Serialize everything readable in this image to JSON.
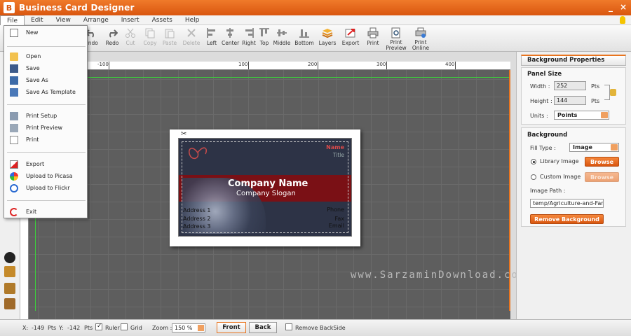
{
  "window": {
    "title": "Business Card Designer",
    "logo": "B",
    "minimize": "_",
    "close": "×"
  },
  "menubar": [
    "File",
    "Edit",
    "View",
    "Arrange",
    "Insert",
    "Assets",
    "Help"
  ],
  "toolbar": {
    "undo": "Undo",
    "redo": "Redo",
    "cut": "Cut",
    "copy": "Copy",
    "paste": "Paste",
    "delete": "Delete",
    "left": "Left",
    "center": "Center",
    "right": "Right",
    "top": "Top",
    "middle": "Middle",
    "bottom": "Bottom",
    "layers": "Layers",
    "export": "Export",
    "print": "Print",
    "print_preview": "Print Preview",
    "print_online": "Print Online"
  },
  "file_menu": {
    "new": "New",
    "open": "Open",
    "save": "Save",
    "save_as": "Save As",
    "save_as_template": "Save As Template",
    "print_setup": "Print Setup",
    "print_preview": "Print Preview",
    "print": "Print",
    "export": "Export",
    "upload_picasa": "Upload to Picasa",
    "upload_flickr": "Upload to Flickr",
    "exit": "Exit"
  },
  "ruler": {
    "labels": [
      "-100",
      "100",
      "200",
      "300",
      "400"
    ]
  },
  "card": {
    "name_small": "Name",
    "title_small": "Title",
    "company_name": "Company Name",
    "company_slogan": "Company Slogan",
    "address1": "Address 1",
    "address2": "Address 2",
    "address3": "Address 3",
    "phone": "Phone",
    "fax": "Fax",
    "email": "Email"
  },
  "watermark": "www.SarzaminDownload.com",
  "right_panel": {
    "title": "Background Properties",
    "panel_size": {
      "heading": "Panel Size",
      "width_label": "Width :",
      "width_value": "252",
      "width_unit": "Pts",
      "height_label": "Height :",
      "height_value": "144",
      "height_unit": "Pts",
      "units_label": "Units :",
      "units_value": "Points"
    },
    "background": {
      "heading": "Background",
      "fill_type_label": "Fill Type :",
      "fill_type_value": "Image",
      "library_image": "Library Image",
      "custom_image": "Custom Image",
      "browse": "Browse",
      "image_path_label": "Image Path :",
      "image_path_value": "temp/Agriculture-and-Farm",
      "remove_background": "Remove Background"
    }
  },
  "statusbar": {
    "x_label": "X:",
    "x_value": "-149",
    "x_unit": "Pts",
    "y_label": "Y:",
    "y_value": "-142",
    "y_unit": "Pts",
    "ruler": "Ruler",
    "grid": "Grid",
    "zoom_label": "Zoom :",
    "zoom_value": "150 %",
    "front": "Front",
    "back": "Back",
    "remove_backside": "Remove BackSide"
  },
  "colors": {
    "accent": "#e8741f",
    "band": "#7a1015",
    "card_bg": "#2d3346",
    "name_red": "#d94a4a"
  }
}
